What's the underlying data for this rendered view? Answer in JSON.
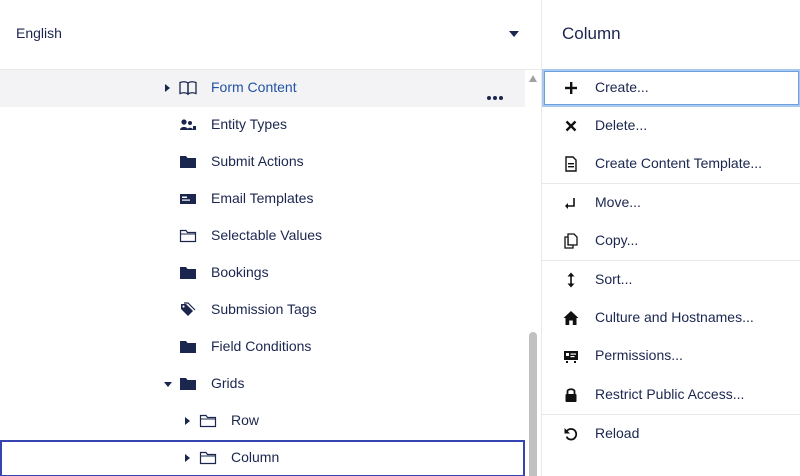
{
  "language": {
    "selected": "English"
  },
  "tree": {
    "items": [
      {
        "label": "Form Content",
        "icon": "book-icon",
        "expand": "collapsed"
      },
      {
        "label": "Entity Types",
        "icon": "users-icon",
        "expand": "none"
      },
      {
        "label": "Submit Actions",
        "icon": "folder-icon",
        "expand": "none"
      },
      {
        "label": "Email Templates",
        "icon": "email-template-icon",
        "expand": "none"
      },
      {
        "label": "Selectable Values",
        "icon": "folder-outline-icon",
        "expand": "none"
      },
      {
        "label": "Bookings",
        "icon": "folder-icon",
        "expand": "none"
      },
      {
        "label": "Submission Tags",
        "icon": "tags-icon",
        "expand": "none"
      },
      {
        "label": "Field Conditions",
        "icon": "folder-icon",
        "expand": "none"
      },
      {
        "label": "Grids",
        "icon": "folder-icon",
        "expand": "expanded"
      },
      {
        "label": "Row",
        "icon": "folder-outline-icon",
        "expand": "collapsed"
      },
      {
        "label": "Column",
        "icon": "folder-outline-icon",
        "expand": "collapsed"
      }
    ]
  },
  "actions": {
    "title": "Column",
    "items": [
      {
        "label": "Create...",
        "icon": "plus-icon"
      },
      {
        "label": "Delete...",
        "icon": "delete-x-icon"
      },
      {
        "label": "Create Content Template...",
        "icon": "document-template-icon"
      },
      {
        "label": "Move...",
        "icon": "move-arrow-icon"
      },
      {
        "label": "Copy...",
        "icon": "copy-icon"
      },
      {
        "label": "Sort...",
        "icon": "sort-arrows-icon"
      },
      {
        "label": "Culture and Hostnames...",
        "icon": "home-icon"
      },
      {
        "label": "Permissions...",
        "icon": "permissions-icon"
      },
      {
        "label": "Restrict Public Access...",
        "icon": "lock-icon"
      },
      {
        "label": "Reload",
        "icon": "reload-icon"
      }
    ]
  }
}
